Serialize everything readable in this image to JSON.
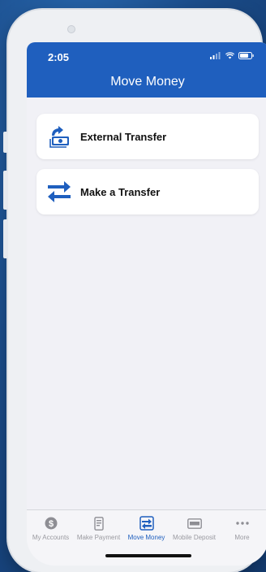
{
  "status_bar": {
    "time": "2:05"
  },
  "header": {
    "title": "Move Money"
  },
  "options": [
    {
      "label": "External Transfer",
      "icon": "external-transfer-icon"
    },
    {
      "label": "Make a Transfer",
      "icon": "transfer-arrows-icon"
    }
  ],
  "tab_bar": {
    "items": [
      {
        "label": "My Accounts",
        "icon": "dollar-coin-icon",
        "active": false
      },
      {
        "label": "Make Payment",
        "icon": "payment-device-icon",
        "active": false
      },
      {
        "label": "Move Money",
        "icon": "move-money-icon",
        "active": true
      },
      {
        "label": "Mobile Deposit",
        "icon": "check-card-icon",
        "active": false
      },
      {
        "label": "More",
        "icon": "more-dots-icon",
        "active": false
      }
    ]
  },
  "colors": {
    "brand_blue": "#1f5fbe",
    "background": "#f1f1f6"
  }
}
